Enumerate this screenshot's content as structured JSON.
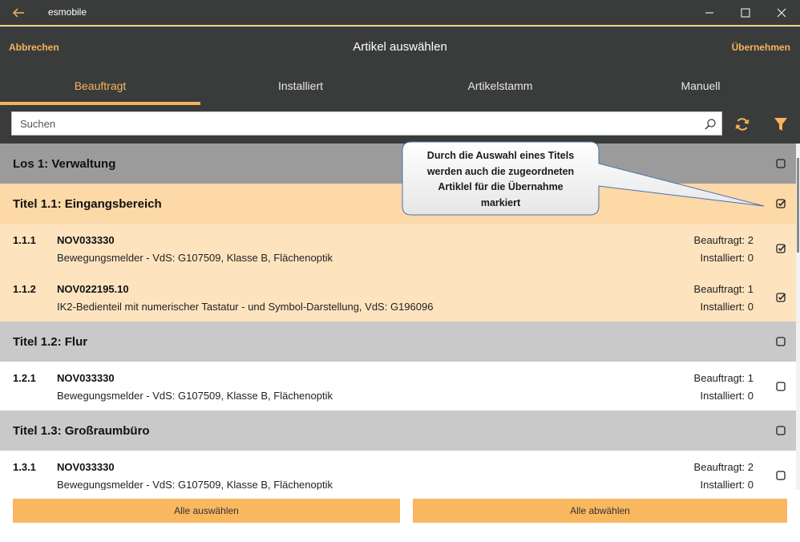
{
  "window": {
    "app_name": "esmobile"
  },
  "header": {
    "cancel": "Abbrechen",
    "title": "Artikel auswählen",
    "apply": "Übernehmen"
  },
  "tabs": [
    {
      "label": "Beauftragt",
      "active": true
    },
    {
      "label": "Installiert",
      "active": false
    },
    {
      "label": "Artikelstamm",
      "active": false
    },
    {
      "label": "Manuell",
      "active": false
    }
  ],
  "search": {
    "placeholder": "Suchen",
    "value": ""
  },
  "list": {
    "los": {
      "label": "Los 1: Verwaltung",
      "checked": false
    },
    "title_1_1": {
      "label": "Titel 1.1: Eingangsbereich",
      "checked": true
    },
    "item_1_1_1": {
      "num": "1.1.1",
      "code": "NOV033330",
      "desc": "Bewegungsmelder  -  VdS: G107509, Klasse B, Flächenoptik",
      "ordered": "Beauftragt: 2",
      "installed": "Installiert: 0",
      "checked": true
    },
    "item_1_1_2": {
      "num": "1.1.2",
      "code": "NOV022195.10",
      "desc": "IK2-Bedienteil mit numerischer Tastatur  -  und Symbol-Darstellung, VdS: G196096",
      "ordered": "Beauftragt: 1",
      "installed": "Installiert: 0",
      "checked": true
    },
    "title_1_2": {
      "label": "Titel 1.2: Flur",
      "checked": false
    },
    "item_1_2_1": {
      "num": "1.2.1",
      "code": "NOV033330",
      "desc": "Bewegungsmelder  -  VdS: G107509, Klasse B, Flächenoptik",
      "ordered": "Beauftragt: 1",
      "installed": "Installiert: 0",
      "checked": false
    },
    "title_1_3": {
      "label": "Titel 1.3: Großraumbüro",
      "checked": false
    },
    "item_1_3_1": {
      "num": "1.3.1",
      "code": "NOV033330",
      "desc": "Bewegungsmelder  -  VdS: G107509, Klasse B, Flächenoptik",
      "ordered": "Beauftragt: 2",
      "installed": "Installiert: 0",
      "checked": false
    }
  },
  "footer": {
    "select_all": "Alle auswählen",
    "deselect_all": "Alle abwählen"
  },
  "callout": {
    "line1": "Durch die Auswahl eines Titels",
    "line2": "werden auch die zugeordneten",
    "line3": "Artiklel für die Übernahme",
    "line4": "markiert"
  },
  "colors": {
    "accent": "#f5b35a",
    "header_bg": "#3a3c3b",
    "selected_title": "#fcd9a7",
    "selected_item": "#fde4bf",
    "button": "#f9b760"
  },
  "icons": [
    "back-arrow-icon",
    "minimize-icon",
    "maximize-icon",
    "close-icon",
    "search-icon",
    "refresh-icon",
    "filter-icon",
    "checkbox-icon"
  ]
}
